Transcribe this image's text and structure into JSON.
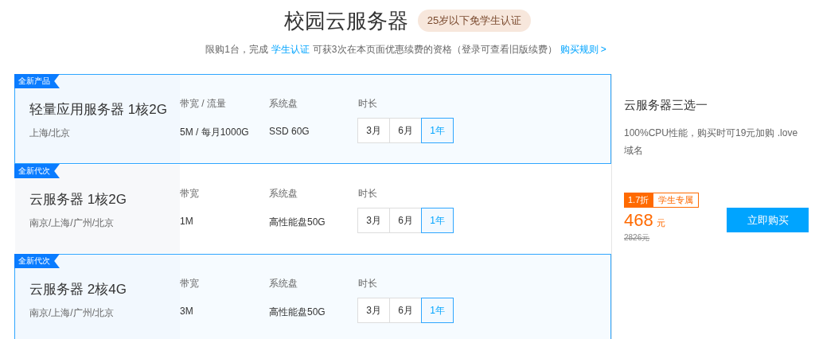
{
  "header": {
    "title": "校园云服务器",
    "badge": "25岁以下免学生认证"
  },
  "notice": {
    "before": "限购1台，完成",
    "link": "学生认证",
    "after": "可获3次在本页面优惠续费的资格（登录可查看旧版续费）",
    "rules_link": "购买规则 >"
  },
  "products": [
    {
      "tag": "全新产品",
      "name": "轻量应用服务器 1核2G",
      "regions": "上海/北京",
      "selected": true,
      "specs": [
        {
          "label": "带宽 / 流量",
          "value": "5M / 每月1000G"
        },
        {
          "label": "系统盘",
          "value": "SSD 60G"
        }
      ],
      "duration_label": "时长",
      "durations": [
        {
          "label": "3月",
          "selected": false
        },
        {
          "label": "6月",
          "selected": false
        },
        {
          "label": "1年",
          "selected": true
        }
      ]
    },
    {
      "tag": "全新代次",
      "name": "云服务器 1核2G",
      "regions": "南京/上海/广州/北京",
      "selected": false,
      "specs": [
        {
          "label": "带宽",
          "value": "1M"
        },
        {
          "label": "系统盘",
          "value": "高性能盘50G"
        }
      ],
      "duration_label": "时长",
      "durations": [
        {
          "label": "3月",
          "selected": false
        },
        {
          "label": "6月",
          "selected": false
        },
        {
          "label": "1年",
          "selected": true
        }
      ]
    },
    {
      "tag": "全新代次",
      "name": "云服务器 2核4G",
      "regions": "南京/上海/广州/北京",
      "selected": true,
      "specs": [
        {
          "label": "带宽",
          "value": "3M"
        },
        {
          "label": "系统盘",
          "value": "高性能盘50G"
        }
      ],
      "duration_label": "时长",
      "durations": [
        {
          "label": "3月",
          "selected": false
        },
        {
          "label": "6月",
          "selected": false
        },
        {
          "label": "1年",
          "selected": true
        }
      ]
    }
  ],
  "summary": {
    "title": "云服务器三选一",
    "description": "100%CPU性能，购买时可19元加购 .love 域名",
    "discount": "1.7折",
    "student_tag": "学生专属",
    "price": "468",
    "currency": "元",
    "original_price": "2826元",
    "buy_button": "立即购买"
  }
}
